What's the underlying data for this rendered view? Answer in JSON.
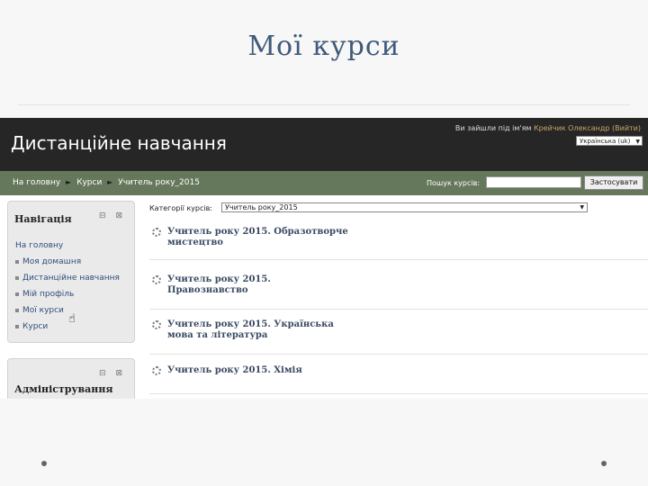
{
  "slide": {
    "title": "Мої курси"
  },
  "header": {
    "site_name": "Дистанційне навчання",
    "login_prefix": "Ви зайшли під ім'ям",
    "login_user": "Крейчик Олександр (Вийти)",
    "language": "Українська (uk)"
  },
  "navbar": {
    "breadcrumb": [
      "На головну",
      "Курси",
      "Учитель року_2015"
    ],
    "breadcrumb_sep": "►",
    "search_label": "Пошук курсів:",
    "search_value": "",
    "search_button": "Застосувати"
  },
  "nav_block": {
    "title": "Навігація",
    "controls": "⊟ ⊠",
    "home": "На головну",
    "items": [
      "Моя домашня",
      "Дистанційне навчання",
      "Мій профіль",
      "Мої курси",
      "Курси"
    ]
  },
  "admin_block": {
    "title": "Адміністрування",
    "controls": "⊟ ⊠"
  },
  "category": {
    "label": "Категорії курсів:",
    "selected": "Учитель року_2015"
  },
  "courses": [
    {
      "line1": "Учитель року 2015. Образотворче",
      "line2": "мистецтво"
    },
    {
      "line1": "Учитель року 2015.",
      "line2": "Правознавство"
    },
    {
      "line1": "Учитель року 2015. Українська",
      "line2": "мова та література"
    },
    {
      "line1": "Учитель року 2015. Хімія",
      "line2": ""
    }
  ]
}
